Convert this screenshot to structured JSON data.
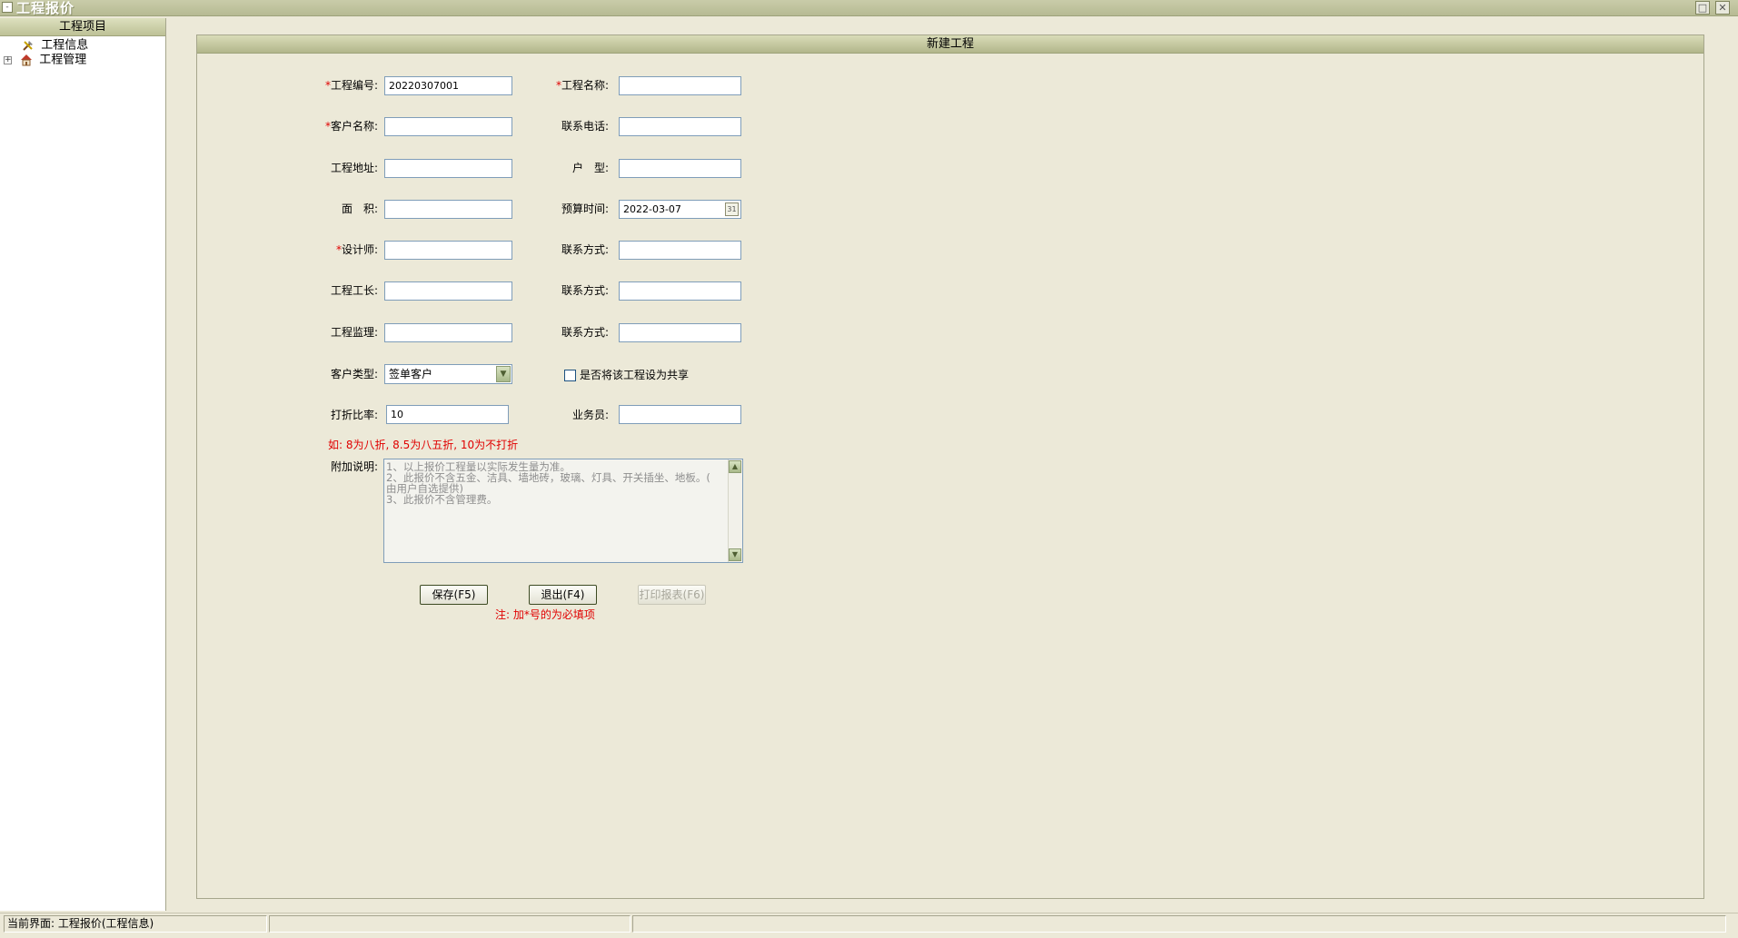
{
  "window": {
    "title": "工程报价",
    "minimize_glyph": "□",
    "close_glyph": "✕"
  },
  "sidebar": {
    "header": "工程项目",
    "items": [
      {
        "label": "工程信息",
        "icon": "tools-icon",
        "expand": ""
      },
      {
        "label": "工程管理",
        "icon": "house-icon",
        "expand": "+"
      }
    ]
  },
  "form": {
    "header": "新建工程",
    "fields": {
      "project_no": {
        "label": "工程编号:",
        "value": "20220307001",
        "required": "*"
      },
      "project_name": {
        "label": "工程名称:",
        "value": "",
        "required": "*"
      },
      "customer_name": {
        "label": "客户名称:",
        "value": "",
        "required": "*"
      },
      "phone": {
        "label": "联系电话:",
        "value": ""
      },
      "address": {
        "label": "工程地址:",
        "value": ""
      },
      "house_type": {
        "label": "户　型:",
        "value": ""
      },
      "area": {
        "label": "面　积:",
        "value": ""
      },
      "budget_time": {
        "label": "预算时间:",
        "value": "2022-03-07"
      },
      "designer": {
        "label": "设计师:",
        "value": "",
        "required": "*"
      },
      "designer_contact": {
        "label": "联系方式:",
        "value": ""
      },
      "foreman": {
        "label": "工程工长:",
        "value": ""
      },
      "foreman_contact": {
        "label": "联系方式:",
        "value": ""
      },
      "supervisor": {
        "label": "工程监理:",
        "value": ""
      },
      "supervisor_contact": {
        "label": "联系方式:",
        "value": ""
      },
      "customer_type": {
        "label": "客户类型:",
        "value": "签单客户"
      },
      "share": {
        "label": "是否将该工程设为共享",
        "checked": false
      },
      "discount": {
        "label": "打折比率:",
        "value": "10"
      },
      "salesman": {
        "label": "业务员:",
        "value": ""
      }
    },
    "discount_hint": "如: 8为八折, 8.5为八五折, 10为不打折",
    "remarks": {
      "label": "附加说明:",
      "lines": [
        "1、以上报价工程量以实际发生量为准。",
        "2、此报价不含五金、洁具、墙地砖，玻璃、灯具、开关插坐、地板。(",
        "由用户自选提供)",
        "3、此报价不含管理费。"
      ]
    },
    "buttons": {
      "save": "保存(F5)",
      "exit": "退出(F4)",
      "print": "打印报表(F6)"
    },
    "required_note": "注: 加*号的为必填项"
  },
  "statusbar": {
    "current": "当前界面: 工程报价(工程信息)"
  }
}
